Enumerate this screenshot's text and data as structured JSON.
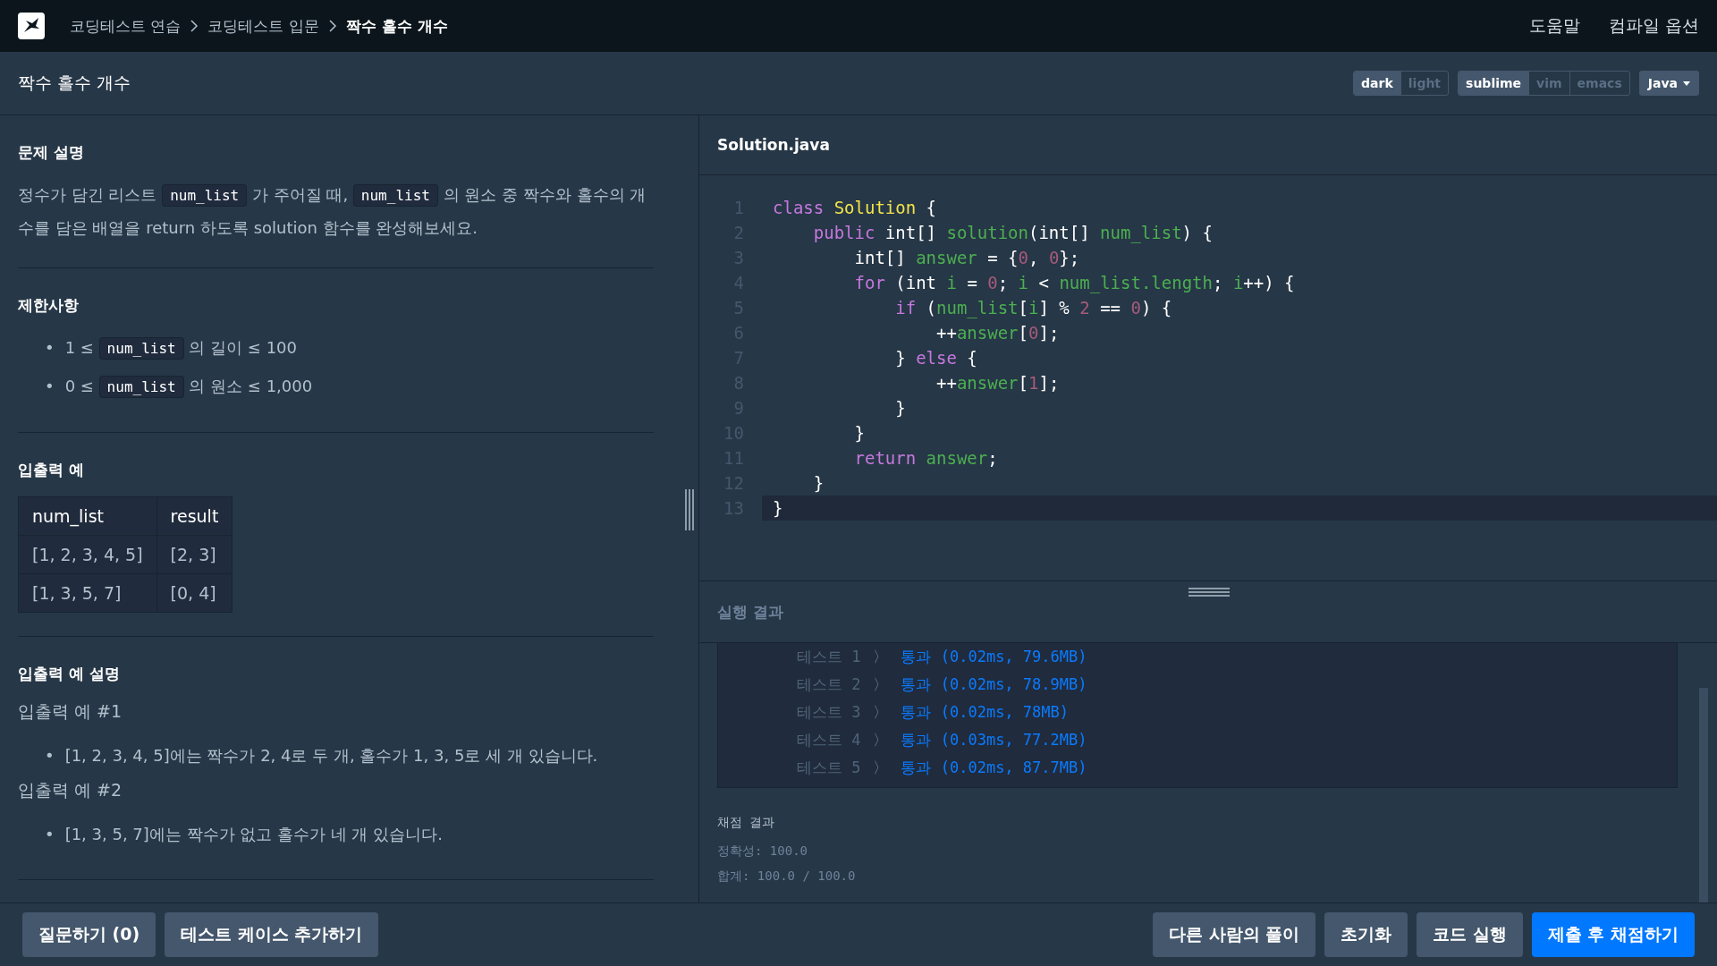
{
  "header": {
    "breadcrumbs": [
      {
        "label": "코딩테스트 연습",
        "current": false
      },
      {
        "label": "코딩테스트 입문",
        "current": false
      },
      {
        "label": "짝수 홀수 개수",
        "current": true
      }
    ],
    "links": [
      "도움말",
      "컴파일 옵션"
    ]
  },
  "toolbar": {
    "title": "짝수 홀수 개수",
    "groups": [
      [
        {
          "label": "dark",
          "selected": true
        },
        {
          "label": "light",
          "selected": false
        }
      ],
      [
        {
          "label": "sublime",
          "selected": true
        },
        {
          "label": "vim",
          "selected": false
        },
        {
          "label": "emacs",
          "selected": false
        }
      ]
    ],
    "language": "Java"
  },
  "problem": {
    "sections": [
      {
        "kind": "paragraph",
        "title": "문제 설명",
        "segments": [
          {
            "kind": "text",
            "text": "정수가 담긴 리스트 "
          },
          {
            "kind": "code",
            "text": "num_list"
          },
          {
            "kind": "text",
            "text": " 가 주어질 때, "
          },
          {
            "kind": "code",
            "text": "num_list"
          },
          {
            "kind": "text",
            "text": " 의 원소 중 짝수와 홀수의 개수를 담은 배열을 return 하도록 solution 함수를 완성해보세요."
          }
        ]
      },
      {
        "kind": "bullets",
        "title": "제한사항",
        "items": [
          {
            "marker": "•",
            "segments": [
              {
                "kind": "text",
                "text": "1 ≤ "
              },
              {
                "kind": "code",
                "text": "num_list"
              },
              {
                "kind": "text",
                "text": " 의 길이 ≤ 100"
              }
            ]
          },
          {
            "marker": "•",
            "segments": [
              {
                "kind": "text",
                "text": "0 ≤ "
              },
              {
                "kind": "code",
                "text": "num_list"
              },
              {
                "kind": "text",
                "text": " 의 원소 ≤ 1,000"
              }
            ]
          }
        ]
      },
      {
        "kind": "table",
        "title": "입출력 예",
        "columns": [
          "num_list",
          "result"
        ],
        "rows": [
          [
            "[1, 2, 3, 4, 5]",
            "[2, 3]"
          ],
          [
            "[1, 3, 5, 7]",
            "[0, 4]"
          ]
        ]
      },
      {
        "kind": "examples",
        "title": "입출력 예 설명",
        "examples": [
          {
            "heading": "입출력 예 #1",
            "items": [
              {
                "marker": "•",
                "text": "[1, 2, 3, 4, 5]에는 짝수가 2, 4로 두 개, 홀수가 1, 3, 5로 세 개 있습니다."
              }
            ]
          },
          {
            "heading": "입출력 예 #2",
            "items": [
              {
                "marker": "•",
                "text": "[1, 3, 5, 7]에는 짝수가 없고 홀수가 네 개 있습니다."
              }
            ]
          }
        ]
      }
    ]
  },
  "editor": {
    "filename": "Solution.java",
    "lines": [
      {
        "number": "1",
        "active": false,
        "tokens": [
          {
            "kind": "keyword",
            "text": "class "
          },
          {
            "kind": "type",
            "text": "Solution"
          },
          {
            "kind": "plain",
            "text": " {"
          }
        ]
      },
      {
        "number": "2",
        "active": false,
        "tokens": [
          {
            "kind": "keyword",
            "text": "    public"
          },
          {
            "kind": "plain",
            "text": " int[] "
          },
          {
            "kind": "name",
            "text": "solution"
          },
          {
            "kind": "plain",
            "text": "(int[] "
          },
          {
            "kind": "name",
            "text": "num_list"
          },
          {
            "kind": "plain",
            "text": ") {"
          }
        ]
      },
      {
        "number": "3",
        "active": false,
        "tokens": [
          {
            "kind": "plain",
            "text": "        int[] "
          },
          {
            "kind": "name",
            "text": "answer"
          },
          {
            "kind": "plain",
            "text": " = {"
          },
          {
            "kind": "number",
            "text": "0"
          },
          {
            "kind": "plain",
            "text": ", "
          },
          {
            "kind": "number",
            "text": "0"
          },
          {
            "kind": "plain",
            "text": "};"
          }
        ]
      },
      {
        "number": "4",
        "active": false,
        "tokens": [
          {
            "kind": "keyword",
            "text": "        for"
          },
          {
            "kind": "plain",
            "text": " (int "
          },
          {
            "kind": "name",
            "text": "i"
          },
          {
            "kind": "plain",
            "text": " = "
          },
          {
            "kind": "number",
            "text": "0"
          },
          {
            "kind": "plain",
            "text": "; "
          },
          {
            "kind": "name",
            "text": "i"
          },
          {
            "kind": "plain",
            "text": " < "
          },
          {
            "kind": "name",
            "text": "num_list.length"
          },
          {
            "kind": "plain",
            "text": "; "
          },
          {
            "kind": "name",
            "text": "i"
          },
          {
            "kind": "plain",
            "text": "++) {"
          }
        ]
      },
      {
        "number": "5",
        "active": false,
        "tokens": [
          {
            "kind": "keyword",
            "text": "            if"
          },
          {
            "kind": "plain",
            "text": " ("
          },
          {
            "kind": "name",
            "text": "num_list"
          },
          {
            "kind": "plain",
            "text": "["
          },
          {
            "kind": "name",
            "text": "i"
          },
          {
            "kind": "plain",
            "text": "] % "
          },
          {
            "kind": "number",
            "text": "2"
          },
          {
            "kind": "plain",
            "text": " == "
          },
          {
            "kind": "number",
            "text": "0"
          },
          {
            "kind": "plain",
            "text": ") {"
          }
        ]
      },
      {
        "number": "6",
        "active": false,
        "tokens": [
          {
            "kind": "plain",
            "text": "                ++"
          },
          {
            "kind": "name",
            "text": "answer"
          },
          {
            "kind": "plain",
            "text": "["
          },
          {
            "kind": "number",
            "text": "0"
          },
          {
            "kind": "plain",
            "text": "];"
          }
        ]
      },
      {
        "number": "7",
        "active": false,
        "tokens": [
          {
            "kind": "plain",
            "text": "            } "
          },
          {
            "kind": "keyword",
            "text": "else"
          },
          {
            "kind": "plain",
            "text": " {"
          }
        ]
      },
      {
        "number": "8",
        "active": false,
        "tokens": [
          {
            "kind": "plain",
            "text": "                ++"
          },
          {
            "kind": "name",
            "text": "answer"
          },
          {
            "kind": "plain",
            "text": "["
          },
          {
            "kind": "number",
            "text": "1"
          },
          {
            "kind": "plain",
            "text": "];"
          }
        ]
      },
      {
        "number": "9",
        "active": false,
        "tokens": [
          {
            "kind": "plain",
            "text": "            }"
          }
        ]
      },
      {
        "number": "10",
        "active": false,
        "tokens": [
          {
            "kind": "plain",
            "text": "        }"
          }
        ]
      },
      {
        "number": "11",
        "active": false,
        "tokens": [
          {
            "kind": "keyword",
            "text": "        return"
          },
          {
            "kind": "name",
            "text": " answer"
          },
          {
            "kind": "plain",
            "text": ";"
          }
        ]
      },
      {
        "number": "12",
        "active": false,
        "tokens": [
          {
            "kind": "plain",
            "text": "    }"
          }
        ]
      },
      {
        "number": "13",
        "active": true,
        "tokens": [
          {
            "kind": "plain",
            "text": "}"
          }
        ]
      }
    ]
  },
  "results": {
    "title": "실행 결과",
    "tests": [
      {
        "label": "테스트 1",
        "separator": "〉",
        "result": "통과 (0.02ms, 79.6MB)"
      },
      {
        "label": "테스트 2",
        "separator": "〉",
        "result": "통과 (0.02ms, 78.9MB)"
      },
      {
        "label": "테스트 3",
        "separator": "〉",
        "result": "통과 (0.02ms, 78MB)"
      },
      {
        "label": "테스트 4",
        "separator": "〉",
        "result": "통과 (0.03ms, 77.2MB)"
      },
      {
        "label": "테스트 5",
        "separator": "〉",
        "result": "통과 (0.02ms, 87.7MB)"
      }
    ],
    "score_title": "채점 결과",
    "score_lines": [
      "정확성: 100.0",
      "합계: 100.0 / 100.0"
    ]
  },
  "footer": {
    "left_buttons": [
      {
        "label": "질문하기 (0)",
        "primary": false
      },
      {
        "label": "테스트 케이스 추가하기",
        "primary": false
      }
    ],
    "right_buttons": [
      {
        "label": "다른 사람의 풀이",
        "primary": false
      },
      {
        "label": "초기화",
        "primary": false
      },
      {
        "label": "코드 실행",
        "primary": false
      },
      {
        "label": "제출 후 채점하기",
        "primary": true
      }
    ]
  }
}
